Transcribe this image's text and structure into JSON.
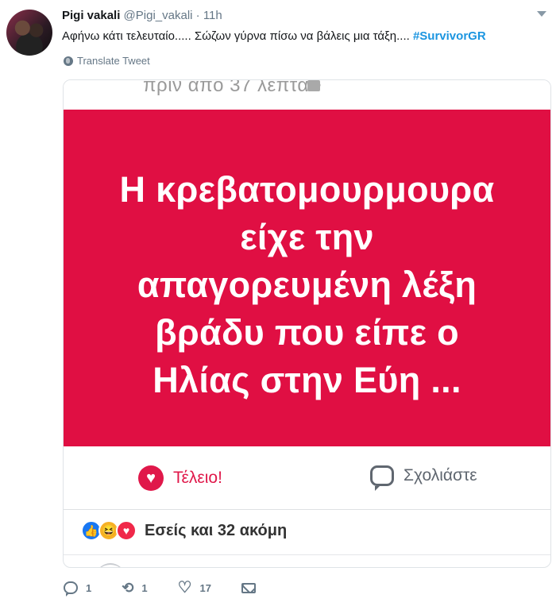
{
  "tweet": {
    "author_name": "Pigi vakali",
    "handle": "@Pigi_vakali",
    "separator": "·",
    "time": "11h",
    "text": "Αφήνω κάτι τελευταίο..... Σώζων γύρνα πίσω να βάλεις μια τάξη.... ",
    "hashtag": "#SurvivorGR",
    "translate_label": "Translate Tweet"
  },
  "media": {
    "top_text": "πριν από 37 λεπτά •",
    "post_lines": [
      "Η κρεβατομουρμουρα",
      "είχε την",
      "απαγορευμένη λέξη",
      "βράδυ που είπε ο",
      "Ηλίας στην Εύη ..."
    ],
    "like_action_label": "Τέλειο!",
    "comment_action_label": "Σχολιάστε",
    "reactions_text": "Εσείς και 32 ακόμη",
    "colors": {
      "post_background": "#e00f43",
      "love": "#e0184a"
    }
  },
  "actions": {
    "replies": "1",
    "retweets": "1",
    "likes": "17"
  },
  "icons": [
    "avatar",
    "globe-icon",
    "image-icon",
    "heart-icon",
    "comment-icon",
    "like-reaction-icon",
    "haha-reaction-icon",
    "love-reaction-icon",
    "reply-icon",
    "retweet-icon",
    "like-icon",
    "message-icon",
    "caret-down-icon"
  ]
}
